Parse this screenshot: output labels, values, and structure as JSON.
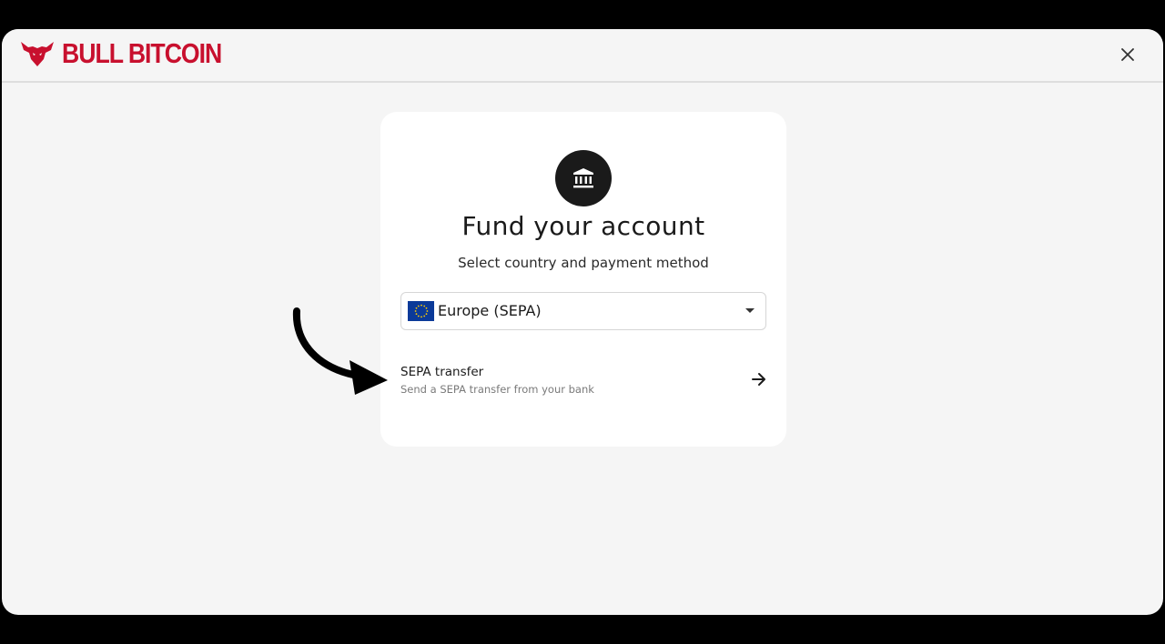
{
  "header": {
    "brand": "BULL BITCOIN",
    "logo_icon": "bull-head-icon",
    "close_icon": "close-icon"
  },
  "card": {
    "icon": "bank-icon",
    "title": "Fund your account",
    "subtitle": "Select country and payment method",
    "region_select": {
      "selected": "Europe (SEPA)",
      "flag": "eu-flag-icon"
    },
    "payment_option": {
      "title": "SEPA transfer",
      "description": "Send a SEPA transfer from your bank",
      "icon": "arrow-right-icon"
    }
  },
  "colors": {
    "brand_red": "#c8102e",
    "background": "#f5f5f5",
    "card": "#ffffff",
    "dark": "#1a1a1a"
  }
}
